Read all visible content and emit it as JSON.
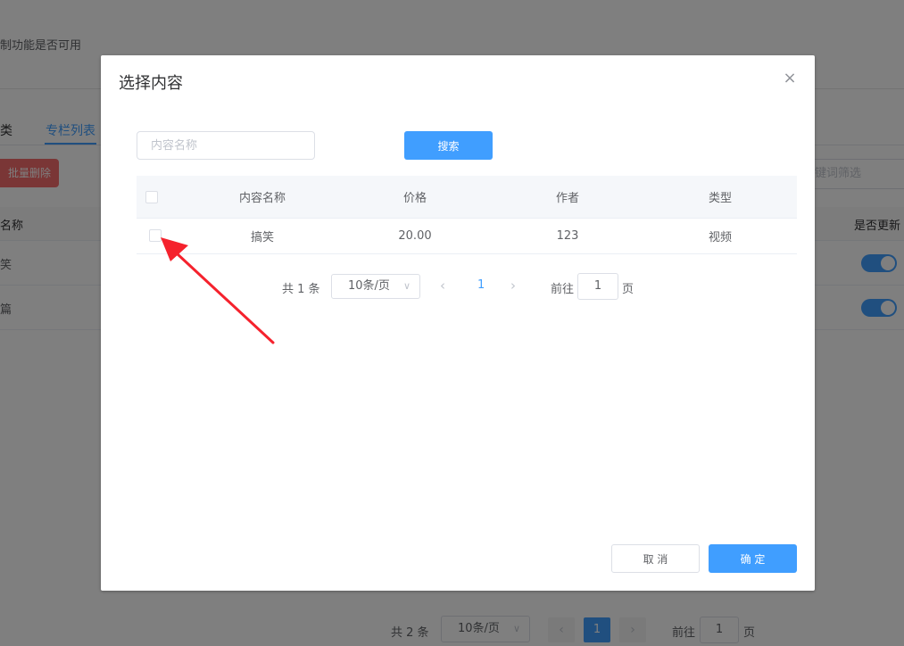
{
  "background": {
    "hint_text": "制功能是否可用",
    "tabs": [
      {
        "label": "类"
      },
      {
        "label": "专栏列表"
      }
    ],
    "batch_delete_label": "批量删除",
    "filter_placeholder": "键词筛选",
    "table_headers": {
      "name": "名称",
      "update": "是否更新"
    },
    "rows": [
      {
        "name": "笑"
      },
      {
        "name": "篇"
      }
    ],
    "pagination": {
      "total": "共 2 条",
      "page_size": "10条/页",
      "current_page": "1",
      "goto_label": "前往",
      "goto_value": "1",
      "page_suffix": "页"
    }
  },
  "dialog": {
    "title": "选择内容",
    "close_icon": "×",
    "search_placeholder": "内容名称",
    "search_button": "搜索",
    "columns": [
      "内容名称",
      "价格",
      "作者",
      "类型"
    ],
    "rows": [
      {
        "name": "搞笑",
        "price": "20.00",
        "author": "123",
        "type": "视频"
      }
    ],
    "pagination": {
      "total": "共 1 条",
      "page_size": "10条/页",
      "prev_icon": "‹",
      "current_page": "1",
      "next_icon": "›",
      "goto_label": "前往",
      "goto_value": "1",
      "page_suffix": "页"
    },
    "cancel_button": "取 消",
    "confirm_button": "确 定"
  },
  "annotation": {
    "arrow_color": "#f5222d"
  },
  "colors": {
    "primary": "#409eff",
    "danger": "#f56c6c"
  }
}
